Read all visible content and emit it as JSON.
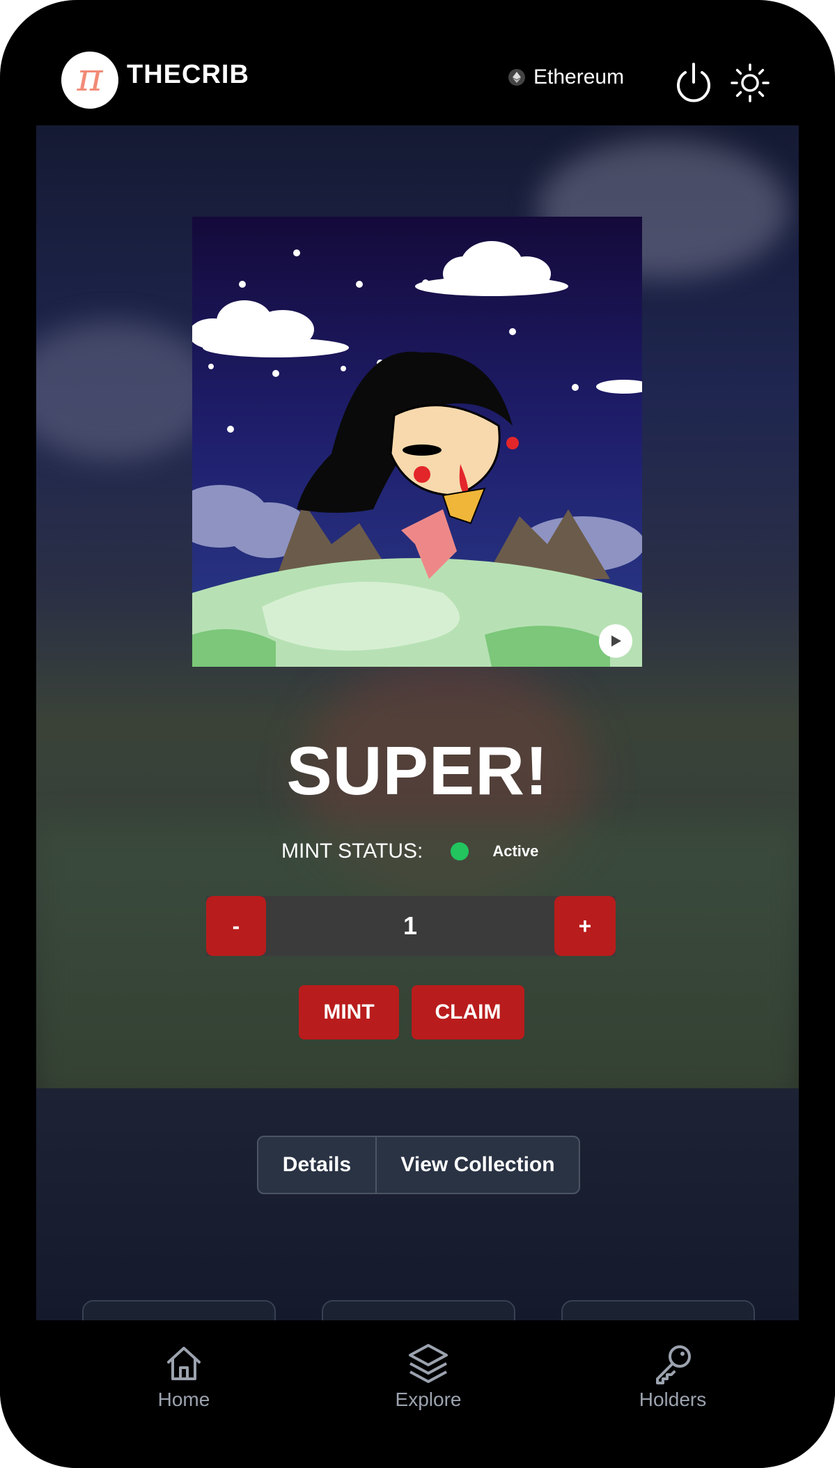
{
  "header": {
    "logo_symbol": "π",
    "brand": "THECRIB",
    "network": "Ethereum",
    "icons": [
      "ethereum-icon",
      "power-icon",
      "sun-icon"
    ]
  },
  "artwork": {
    "play_icon": "play-icon"
  },
  "mint": {
    "title": "SUPER!",
    "status_label": "MINT STATUS:",
    "status_value": "Active",
    "status_color": "#22c55e",
    "quantity": "1",
    "decrement_label": "-",
    "increment_label": "+",
    "mint_label": "MINT",
    "claim_label": "CLAIM",
    "accent": "#b91c1c"
  },
  "tabs": [
    {
      "label": "Details"
    },
    {
      "label": "View Collection"
    }
  ],
  "bottom_nav": [
    {
      "label": "Home",
      "icon": "home-icon"
    },
    {
      "label": "Explore",
      "icon": "layers-icon"
    },
    {
      "label": "Holders",
      "icon": "key-icon"
    }
  ]
}
